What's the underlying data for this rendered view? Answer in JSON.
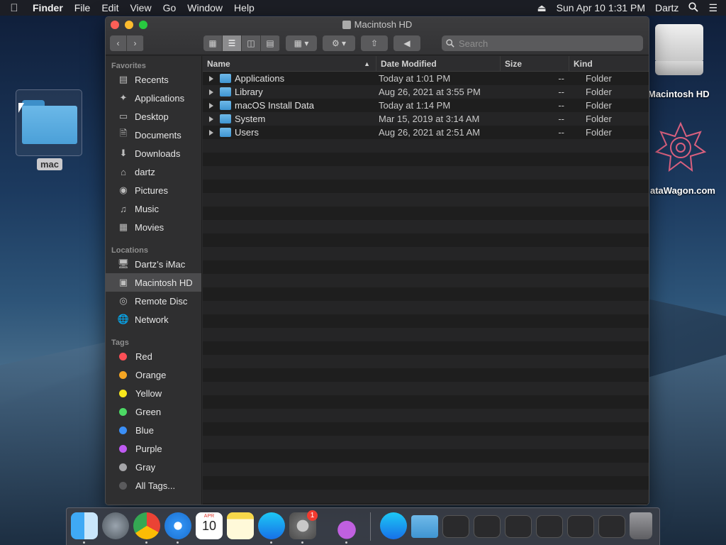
{
  "menubar": {
    "app": "Finder",
    "menus": [
      "File",
      "Edit",
      "View",
      "Go",
      "Window",
      "Help"
    ],
    "clock": "Sun Apr 10  1:31 PM",
    "user": "Dartz"
  },
  "desktop": {
    "folder_label": "mac",
    "drive_label": "Macintosh HD",
    "app_label": "ataWagon.com"
  },
  "window": {
    "title": "Macintosh HD",
    "search_placeholder": "Search"
  },
  "sidebar": {
    "favorites_header": "Favorites",
    "favorites": [
      {
        "label": "Recents",
        "icon": "recents-icon"
      },
      {
        "label": "Applications",
        "icon": "applications-icon"
      },
      {
        "label": "Desktop",
        "icon": "desktop-icon"
      },
      {
        "label": "Documents",
        "icon": "documents-icon"
      },
      {
        "label": "Downloads",
        "icon": "downloads-icon"
      },
      {
        "label": "dartz",
        "icon": "home-icon"
      },
      {
        "label": "Pictures",
        "icon": "camera-icon"
      },
      {
        "label": "Music",
        "icon": "music-icon"
      },
      {
        "label": "Movies",
        "icon": "film-icon"
      }
    ],
    "locations_header": "Locations",
    "locations": [
      {
        "label": "Dartz’s iMac",
        "icon": "imac-icon"
      },
      {
        "label": "Macintosh HD",
        "icon": "hard-drive-icon"
      },
      {
        "label": "Remote Disc",
        "icon": "disc-icon"
      },
      {
        "label": "Network",
        "icon": "globe-icon"
      }
    ],
    "tags_header": "Tags",
    "tags": [
      {
        "label": "Red",
        "color": "#fc4f56"
      },
      {
        "label": "Orange",
        "color": "#f5a623"
      },
      {
        "label": "Yellow",
        "color": "#f8e71c"
      },
      {
        "label": "Green",
        "color": "#4cd964"
      },
      {
        "label": "Blue",
        "color": "#3b8ff6"
      },
      {
        "label": "Purple",
        "color": "#bf5af2"
      },
      {
        "label": "Gray",
        "color": "#a5a5a8"
      },
      {
        "label": "All Tags...",
        "color": "#5a5a5c"
      }
    ]
  },
  "columns": {
    "name": "Name",
    "date": "Date Modified",
    "size": "Size",
    "kind": "Kind"
  },
  "files": [
    {
      "name": "Applications",
      "date": "Today at 1:01 PM",
      "size": "--",
      "kind": "Folder"
    },
    {
      "name": "Library",
      "date": "Aug 26, 2021 at 3:55 PM",
      "size": "--",
      "kind": "Folder"
    },
    {
      "name": "macOS Install Data",
      "date": "Today at 1:14 PM",
      "size": "--",
      "kind": "Folder"
    },
    {
      "name": "System",
      "date": "Mar 15, 2019 at 3:14 AM",
      "size": "--",
      "kind": "Folder"
    },
    {
      "name": "Users",
      "date": "Aug 26, 2021 at 2:51 AM",
      "size": "--",
      "kind": "Folder"
    }
  ],
  "dock": {
    "calendar_month": "APR",
    "calendar_day": "10",
    "prefs_badge": "1"
  }
}
